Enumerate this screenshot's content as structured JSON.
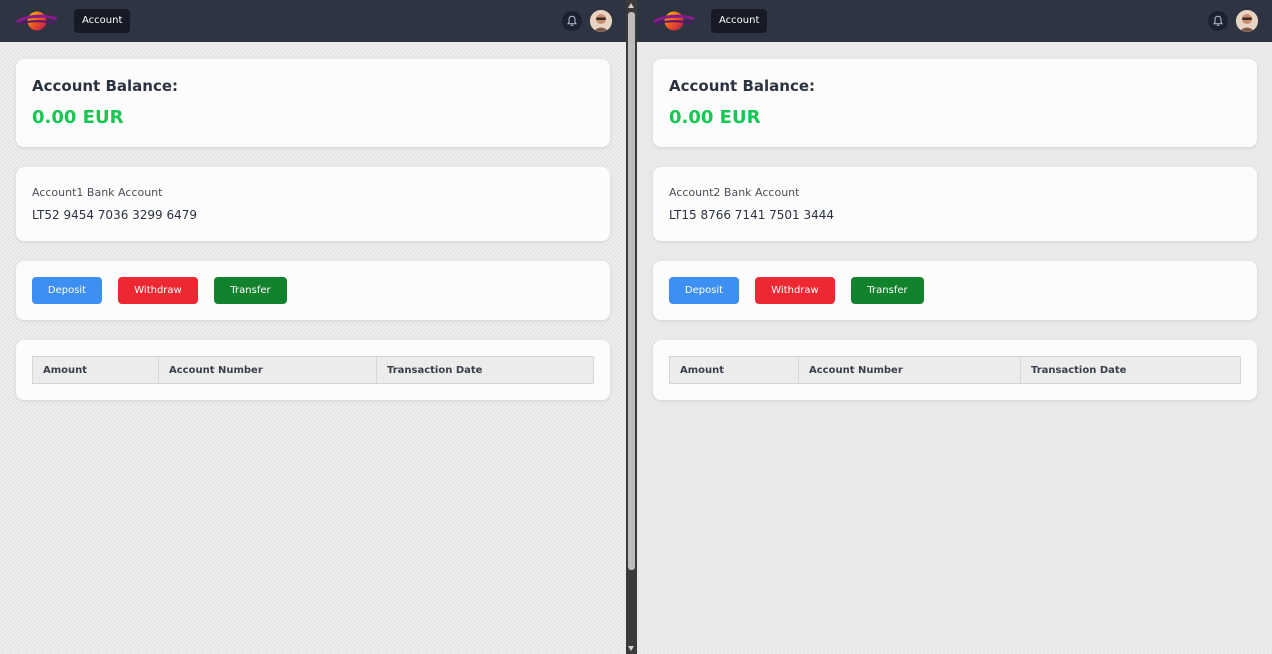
{
  "nav": {
    "tab_label": "Account"
  },
  "colors": {
    "navbar": "#2e3441",
    "balance_green": "#17c653",
    "deposit": "#3e8ff2",
    "withdraw": "#ee2833",
    "transfer": "#13822d"
  },
  "icons": {
    "logo": "brand-logo",
    "bell": "bell-icon",
    "avatar": "user-avatar"
  },
  "left": {
    "balance_title": "Account Balance:",
    "balance_value": "0.00 EUR",
    "account_name": "Account1 Bank Account",
    "account_number": "LT52 9454 7036 3299 6479",
    "buttons": {
      "deposit": "Deposit",
      "withdraw": "Withdraw",
      "transfer": "Transfer"
    },
    "table_headers": [
      "Amount",
      "Account Number",
      "Transaction Date"
    ]
  },
  "right": {
    "balance_title": "Account Balance:",
    "balance_value": "0.00 EUR",
    "account_name": "Account2 Bank Account",
    "account_number": "LT15 8766 7141 7501 3444",
    "buttons": {
      "deposit": "Deposit",
      "withdraw": "Withdraw",
      "transfer": "Transfer"
    },
    "table_headers": [
      "Amount",
      "Account Number",
      "Transaction Date"
    ]
  }
}
